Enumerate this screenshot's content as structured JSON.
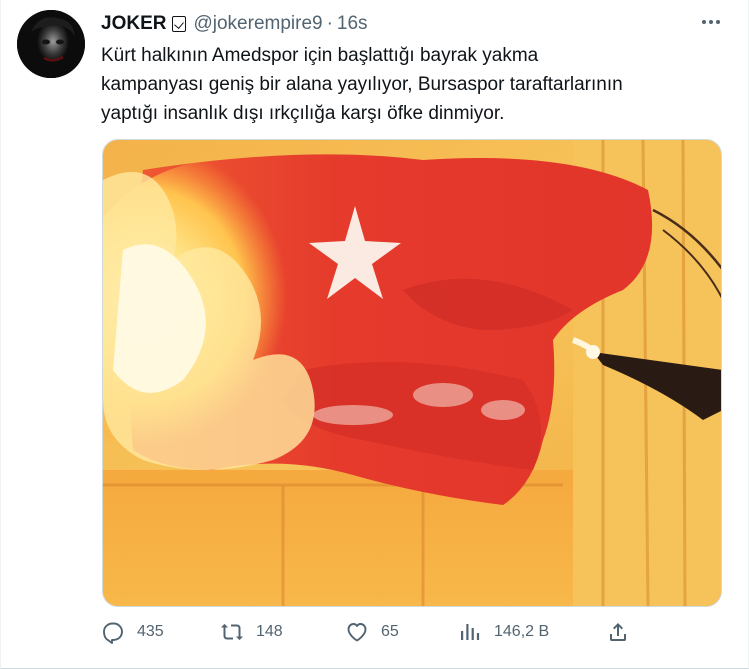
{
  "tweet": {
    "author": {
      "display_name": "JOKER",
      "badge_icon": "verified-box-icon",
      "handle": "@jokerempire9",
      "separator": "·",
      "time": "16s"
    },
    "text_lines": [
      "Kürt halkının Amedspor için başlattığı bayrak yakma",
      "kampanyası geniş bir alana yayılıyor, Bursaspor taraftarlarının",
      "yaptığı insanlık dışı ırkçılığa karşı öfke dinmiyor."
    ],
    "stats": {
      "replies": "435",
      "retweets": "148",
      "likes": "65",
      "views": "146,2 B"
    },
    "icons": {
      "reply": "reply-icon",
      "retweet": "retweet-icon",
      "like": "heart-icon",
      "views": "views-chart-icon",
      "share": "share-icon",
      "more": "more-dots-icon"
    },
    "colors": {
      "text": "#0f1419",
      "muted": "#536471",
      "flag_red": "#e53a2c",
      "flame": "#ffd05a"
    }
  }
}
